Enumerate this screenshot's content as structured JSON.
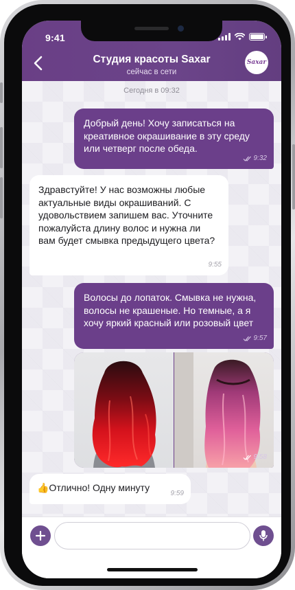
{
  "status_bar": {
    "time": "9:41",
    "battery_level": 1.0
  },
  "header": {
    "title": "Студия красоты Saxar",
    "subtitle": "сейчас в сети",
    "avatar_text": "Saxar",
    "accent_color": "#6b3f8a"
  },
  "chat": {
    "date_label": "Сегодня в 09:32",
    "messages": [
      {
        "direction": "out",
        "text": "Добрый день! Хочу записаться на креативное окрашивание в эту среду или четверг после обеда.",
        "time": "9:32",
        "read": true
      },
      {
        "direction": "in",
        "text": "Здравстуйте! У нас возможны любые актуальные виды окрашиваний. С удовольствием запишем вас. Уточните пожалуйста длину волос и нужна ли вам будет смывка предыдущего цвета?",
        "time": "9:55"
      },
      {
        "direction": "out",
        "text": "Волосы до лопаток. Смывка не нужна, волосы не крашеные. Но темные, а я хочу яркий красный или розовый цвет",
        "time": "9:57",
        "read": true
      },
      {
        "direction": "out",
        "type": "photos",
        "time": "9:58",
        "read": true
      },
      {
        "direction": "in",
        "text": "👍Отлично! Одну минуту",
        "time": "9:59"
      }
    ]
  },
  "input": {
    "placeholder": "",
    "value": ""
  },
  "icons": {
    "back": "chevron-left-icon",
    "add": "plus-icon",
    "mic": "microphone-icon",
    "read_receipt": "double-check-icon"
  }
}
